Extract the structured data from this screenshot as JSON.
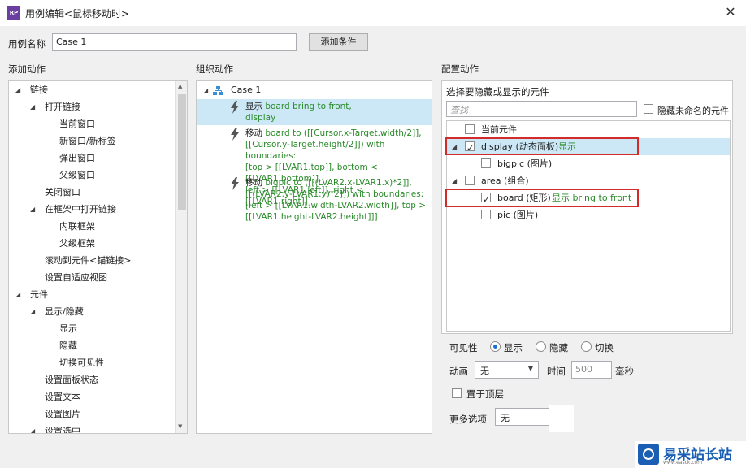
{
  "window": {
    "title": "用例编辑<鼠标移动时>",
    "app_icon_text": "RP",
    "close_glyph": "✕"
  },
  "case_name": {
    "label": "用例名称",
    "value": "Case 1",
    "add_condition_label": "添加条件"
  },
  "add_actions": {
    "header": "添加动作",
    "items": [
      {
        "label": "链接",
        "level": 0,
        "expander": "◢"
      },
      {
        "label": "打开链接",
        "level": 1,
        "expander": "◢"
      },
      {
        "label": "当前窗口",
        "level": 2
      },
      {
        "label": "新窗口/新标签",
        "level": 2
      },
      {
        "label": "弹出窗口",
        "level": 2
      },
      {
        "label": "父级窗口",
        "level": 2
      },
      {
        "label": "关闭窗口",
        "level": 1
      },
      {
        "label": "在框架中打开链接",
        "level": 1,
        "expander": "◢"
      },
      {
        "label": "内联框架",
        "level": 2
      },
      {
        "label": "父级框架",
        "level": 2
      },
      {
        "label": "滚动到元件<锚链接>",
        "level": 1
      },
      {
        "label": "设置自适应视图",
        "level": 1
      },
      {
        "label": "元件",
        "level": 0,
        "expander": "◢"
      },
      {
        "label": "显示/隐藏",
        "level": 1,
        "expander": "◢"
      },
      {
        "label": "显示",
        "level": 2
      },
      {
        "label": "隐藏",
        "level": 2
      },
      {
        "label": "切换可见性",
        "level": 2
      },
      {
        "label": "设置面板状态",
        "level": 1
      },
      {
        "label": "设置文本",
        "level": 1
      },
      {
        "label": "设置图片",
        "level": 1
      },
      {
        "label": "设置选中",
        "level": 1,
        "expander": "◢"
      }
    ],
    "scroll_up": "▲",
    "scroll_down": "▼"
  },
  "organize_actions": {
    "header": "组织动作",
    "case_label": "Case 1",
    "actions": [
      {
        "verb": "显示",
        "lines": [
          "board bring to front,",
          "display"
        ]
      },
      {
        "verb": "移动",
        "lines": [
          "board to ([[Cursor.x-Target.width/2]],",
          "[[Cursor.y-Target.height/2]]) with boundaries:",
          "[top > [[LVAR1.top]], bottom < [[LVAR1.bottom]],",
          "left > [[LVAR1.left]], right < [[LVAR1.right]]]"
        ]
      },
      {
        "verb": "移动",
        "lines": [
          "bigpic to ([[(LVAR2.x-LVAR1.x)*2]],",
          "[[(LVAR2.y-LVAR1.y)*2]]) with boundaries:",
          "[left > [[LVAR1.width-LVAR2.width]], top >",
          "[[LVAR1.height-LVAR2.height]]]"
        ]
      }
    ]
  },
  "configure_actions": {
    "header": "配置动作",
    "select_label": "选择要隐藏或显示的元件",
    "search_placeholder": "查找",
    "hide_unnamed_label": "隐藏未命名的元件",
    "widgets": [
      {
        "name": "当前元件",
        "detail": "",
        "checked": false,
        "expander": ""
      },
      {
        "name": "display (动态面板)",
        "detail": "显示",
        "checked": true,
        "expander": "◢"
      },
      {
        "name": "bigpic (图片)",
        "detail": "",
        "checked": false,
        "expander": ""
      },
      {
        "name": "area (组合)",
        "detail": "",
        "checked": false,
        "expander": "◢"
      },
      {
        "name": "board (矩形)",
        "detail": "显示 bring to front",
        "checked": true,
        "expander": ""
      },
      {
        "name": "pic (图片)",
        "detail": "",
        "checked": false,
        "expander": ""
      }
    ],
    "visibility_label": "可见性",
    "visibility_options": [
      "显示",
      "隐藏",
      "切换"
    ],
    "visibility_selected": "显示",
    "animation_label": "动画",
    "animation_value": "无",
    "time_label": "时间",
    "time_value": "500",
    "ms_label": "毫秒",
    "bring_to_front_label": "置于顶层",
    "more_options_label": "更多选项",
    "more_options_value": "无",
    "dropdown_glyph": "▼"
  },
  "watermark": {
    "text": "易采站长站",
    "sub": "www.easck.com"
  },
  "colors": {
    "selection": "#cce8f7",
    "green_text": "#2a8a2a",
    "highlight_box": "#d42a2a",
    "bolt": "#555555"
  }
}
